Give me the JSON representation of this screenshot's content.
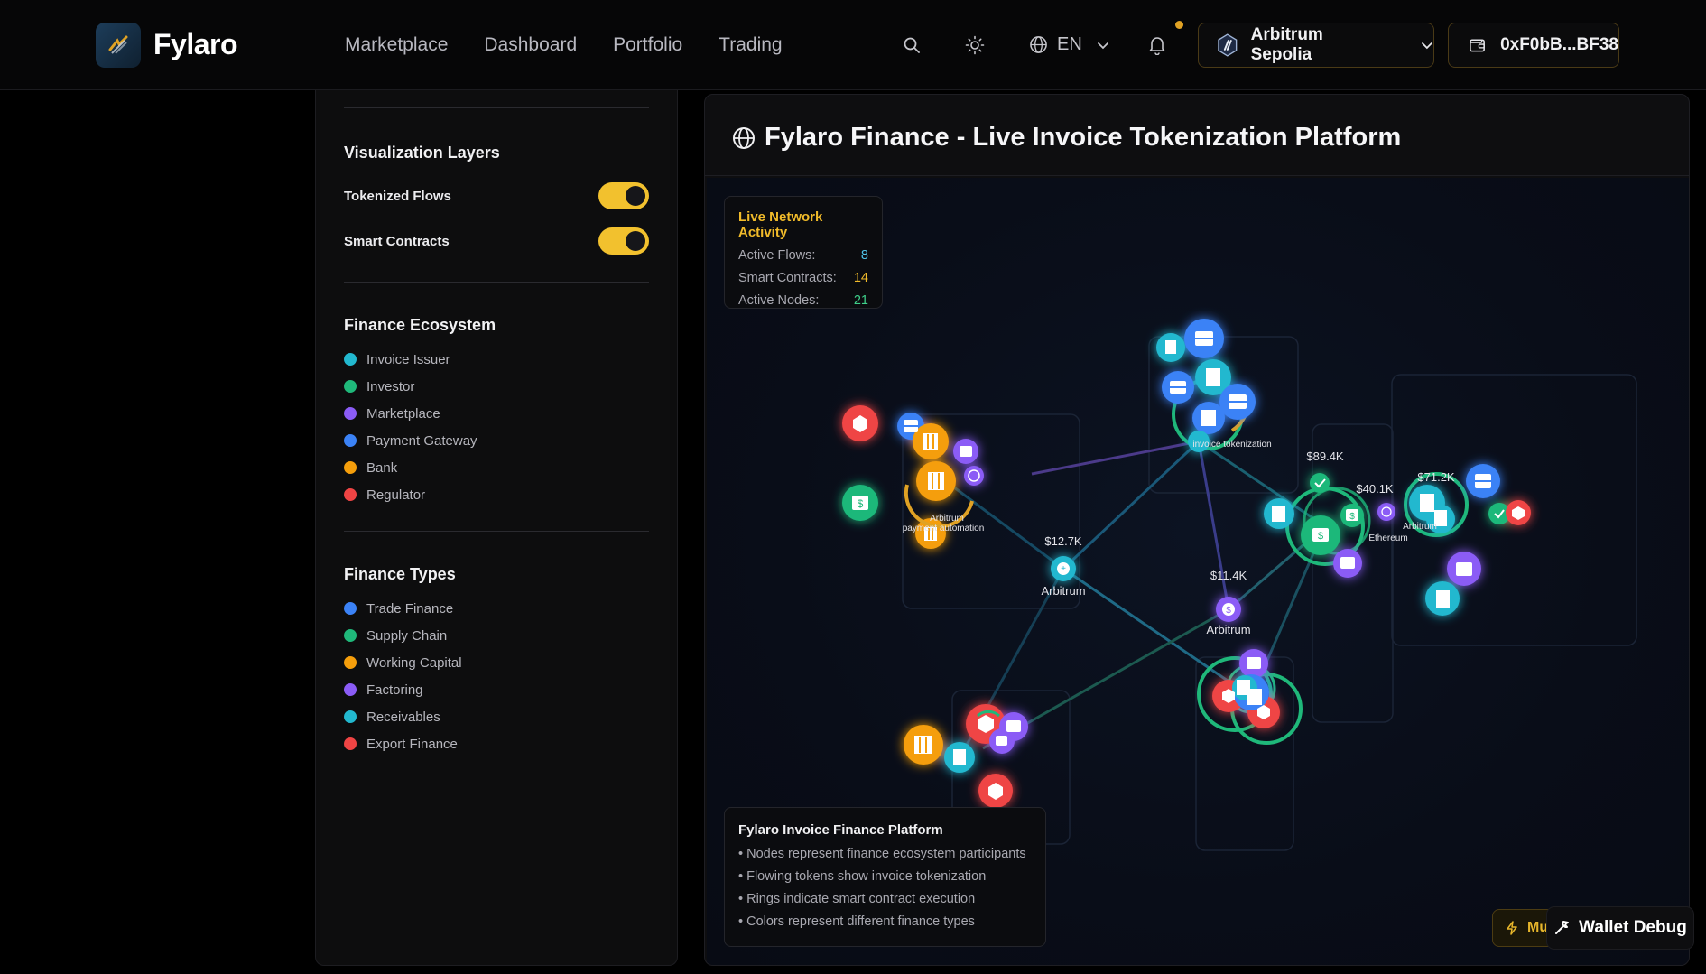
{
  "brand": "Fylaro",
  "nav": [
    "Marketplace",
    "Dashboard",
    "Portfolio",
    "Trading"
  ],
  "lang": "EN",
  "chain": "Arbitrum Sepolia",
  "wallet": "0xF0bB...BF38",
  "sidebar": {
    "layers_title": "Visualization Layers",
    "toggles": [
      {
        "label": "Tokenized Flows",
        "on": true
      },
      {
        "label": "Smart Contracts",
        "on": true
      }
    ],
    "ecosystem_title": "Finance Ecosystem",
    "ecosystem": [
      {
        "label": "Invoice Issuer",
        "color": "#22b8cf"
      },
      {
        "label": "Investor",
        "color": "#1fb87a"
      },
      {
        "label": "Marketplace",
        "color": "#8b5cf6"
      },
      {
        "label": "Payment Gateway",
        "color": "#3b82f6"
      },
      {
        "label": "Bank",
        "color": "#f59e0b"
      },
      {
        "label": "Regulator",
        "color": "#ef4444"
      }
    ],
    "types_title": "Finance Types",
    "types": [
      {
        "label": "Trade Finance",
        "color": "#3b82f6"
      },
      {
        "label": "Supply Chain",
        "color": "#1fb87a"
      },
      {
        "label": "Working Capital",
        "color": "#f59e0b"
      },
      {
        "label": "Factoring",
        "color": "#8b5cf6"
      },
      {
        "label": "Receivables",
        "color": "#22b8cf"
      },
      {
        "label": "Export Finance",
        "color": "#ef4444"
      }
    ]
  },
  "panel": {
    "title": "Fylaro Finance - Live Invoice Tokenization Platform",
    "stats": {
      "title": "Live Network Activity",
      "rows": [
        {
          "label": "Active Flows:",
          "value": "8",
          "color": "#4fc3e8"
        },
        {
          "label": "Smart Contracts:",
          "value": "14",
          "color": "#f1bb2a"
        },
        {
          "label": "Active Nodes:",
          "value": "21",
          "color": "#3fd08a"
        }
      ]
    },
    "info": {
      "title": "Fylaro Invoice Finance Platform",
      "lines": [
        "• Nodes represent finance ecosystem participants",
        "• Flowing tokens show invoice tokenization",
        "• Rings indicate smart contract execution",
        "• Colors represent different finance types"
      ]
    },
    "graph_labels": {
      "v1": "$12.7K",
      "n1": "Arbitrum",
      "v2": "$11.4K",
      "n2": "Arbitrum",
      "v3": "$89.4K",
      "v4": "$40.1K",
      "v5": "$71.2K",
      "n3": "Ethereum",
      "n4": "Arbitrum",
      "n5": "invoice tokenization",
      "n6": "payment automation"
    }
  },
  "buttons": {
    "mu": "Mu",
    "debug": "Wallet Debug"
  }
}
